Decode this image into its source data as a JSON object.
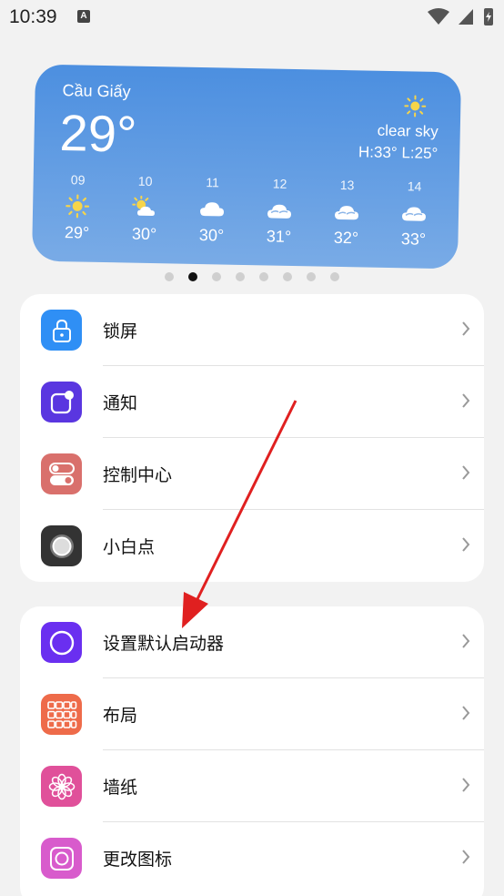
{
  "status_bar": {
    "time": "10:39",
    "notification_icon": "A"
  },
  "weather": {
    "city": "Cầu Giấy",
    "temperature": "29°",
    "condition": "clear sky",
    "high_low": "H:33° L:25°",
    "forecast": [
      {
        "hour": "09",
        "icon": "sun",
        "temp": "29°"
      },
      {
        "hour": "10",
        "icon": "sun-cloud",
        "temp": "30°"
      },
      {
        "hour": "11",
        "icon": "cloud",
        "temp": "30°"
      },
      {
        "hour": "12",
        "icon": "clouds",
        "temp": "31°"
      },
      {
        "hour": "13",
        "icon": "clouds",
        "temp": "32°"
      },
      {
        "hour": "14",
        "icon": "clouds",
        "temp": "33°"
      }
    ]
  },
  "page_indicator": {
    "count": 8,
    "active": 2
  },
  "group1": [
    {
      "label": "锁屏",
      "icon": "lock-icon",
      "color": "#2f8ff5"
    },
    {
      "label": "通知",
      "icon": "notification-icon",
      "color": "#5a36e0"
    },
    {
      "label": "控制中心",
      "icon": "toggle-icon",
      "color": "#d9706c"
    },
    {
      "label": "小白点",
      "icon": "assistive-touch-icon",
      "color": "#333333"
    }
  ],
  "group2": [
    {
      "label": "设置默认启动器",
      "icon": "launcher-icon",
      "color": "#6a2ff0"
    },
    {
      "label": "布局",
      "icon": "grid-icon",
      "color": "#ee6b4a"
    },
    {
      "label": "墙纸",
      "icon": "flower-icon",
      "color": "#e0509a"
    },
    {
      "label": "更改图标",
      "icon": "icon-shape-icon",
      "color": "#d85bcc"
    }
  ]
}
